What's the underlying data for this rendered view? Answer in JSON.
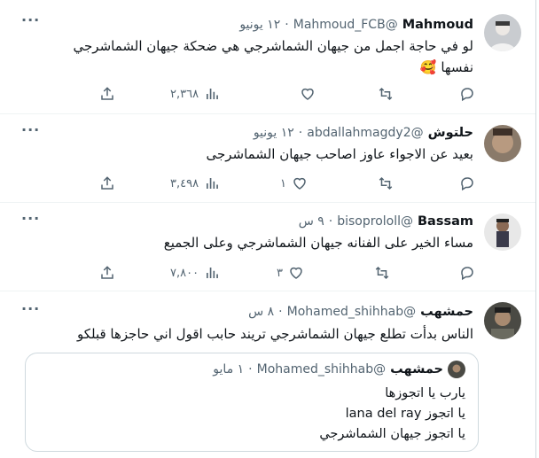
{
  "tweets": [
    {
      "name": "Mahmoud",
      "handle": "@Mahmoud_FCB",
      "time": "١٢ يونيو",
      "text": "لو في حاجة اجمل من جيهان الشماشرجي هي ضحكة جيهان الشماشرجي\nنفسها 🥰",
      "views": "٢,٣٦٨",
      "likes": "",
      "retweets": "",
      "replies": ""
    },
    {
      "name": "حلتوش",
      "handle": "@abdallahmagdy2",
      "time": "١٢ يونيو",
      "text": "بعيد عن الاجواء عاوز اصاحب جيهان الشماشرجى",
      "views": "٣,٤٩٨",
      "likes": "١",
      "retweets": "",
      "replies": ""
    },
    {
      "name": "Bassam",
      "handle": "@bisoprololl",
      "time": "٩ س",
      "text": "مساء الخير على الفنانه جيهان الشماشرجي وعلى الجميع",
      "views": "٧,٨٠٠",
      "likes": "٣",
      "retweets": "",
      "replies": ""
    },
    {
      "name": "حمشهب",
      "handle": "@Mohamed_shihhab",
      "time": "٨ س",
      "text": "الناس بدأت تطلع جيهان الشماشرجي تريند حابب اقول اني حاجزها قبلكو",
      "quote": {
        "name": "حمشهب",
        "handle": "@Mohamed_shihhab",
        "time": "١ مايو",
        "text": "يارب يا اتجوزها\nيا اتجوز lana del ray\nيا اتجوز جيهان الشماشرجي"
      }
    }
  ],
  "separator": "·",
  "more_icon": "···",
  "icons": {
    "reply": "reply-icon",
    "retweet": "retweet-icon",
    "like": "heart-icon",
    "views": "views-icon",
    "share": "share-icon"
  }
}
